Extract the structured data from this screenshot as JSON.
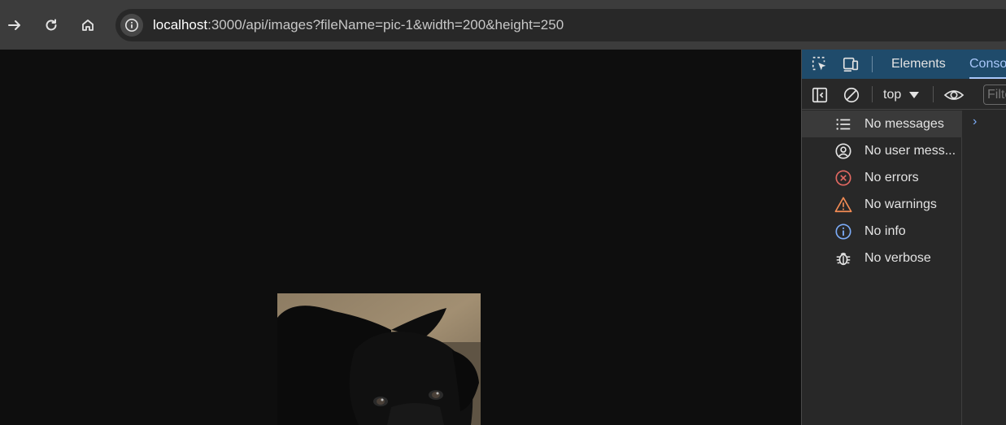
{
  "toolbar": {
    "url_host": "localhost",
    "url_rest": ":3000/api/images?fileName=pic-1&width=200&height=250"
  },
  "devtools": {
    "tabs": [
      {
        "label": "Elements"
      },
      {
        "label": "Conso"
      }
    ],
    "context": "top",
    "filter_placeholder": "Filte",
    "sidebar": [
      {
        "label": "No messages",
        "icon": "list-icon"
      },
      {
        "label": "No user mess...",
        "icon": "user-icon"
      },
      {
        "label": "No errors",
        "icon": "error-icon"
      },
      {
        "label": "No warnings",
        "icon": "warning-icon"
      },
      {
        "label": "No info",
        "icon": "info-icon"
      },
      {
        "label": "No verbose",
        "icon": "bug-icon"
      }
    ],
    "colors": {
      "tab_bar": "#1f4b6b",
      "active_tab": "#a8c7fa",
      "error": "#e46962",
      "warning": "#f28b54",
      "info": "#7cacf8"
    }
  }
}
